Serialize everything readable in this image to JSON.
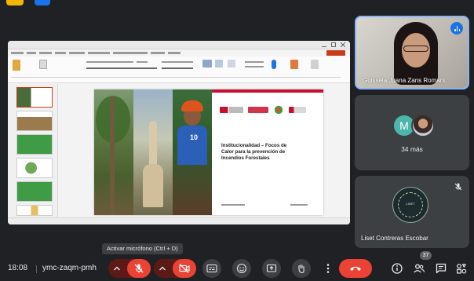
{
  "presenter": {
    "name": "Guissela Juana Zans Romani"
  },
  "others_tile": {
    "avatar_letter": "M",
    "more_label": "34 más"
  },
  "participant_tile": {
    "name": "Liset Contreras Escobar",
    "badge_text": "LISET"
  },
  "slide": {
    "title_lines": [
      "Institucionalidad – Focos de",
      "Calor para la prevención de",
      "Incendios Forestales"
    ],
    "shirt_number": "10"
  },
  "tooltip": {
    "text": "Activar micrófono (Ctrl + D)"
  },
  "bottom_bar": {
    "clock": "18:08",
    "meeting_code": "ymc-zaqm-pmh",
    "participants_count": "37"
  },
  "colors": {
    "background": "#202124",
    "tile": "#3c4043",
    "danger": "#ea4335",
    "muted_red": "#5c1a17",
    "accent_blue": "#8ab4f8"
  }
}
